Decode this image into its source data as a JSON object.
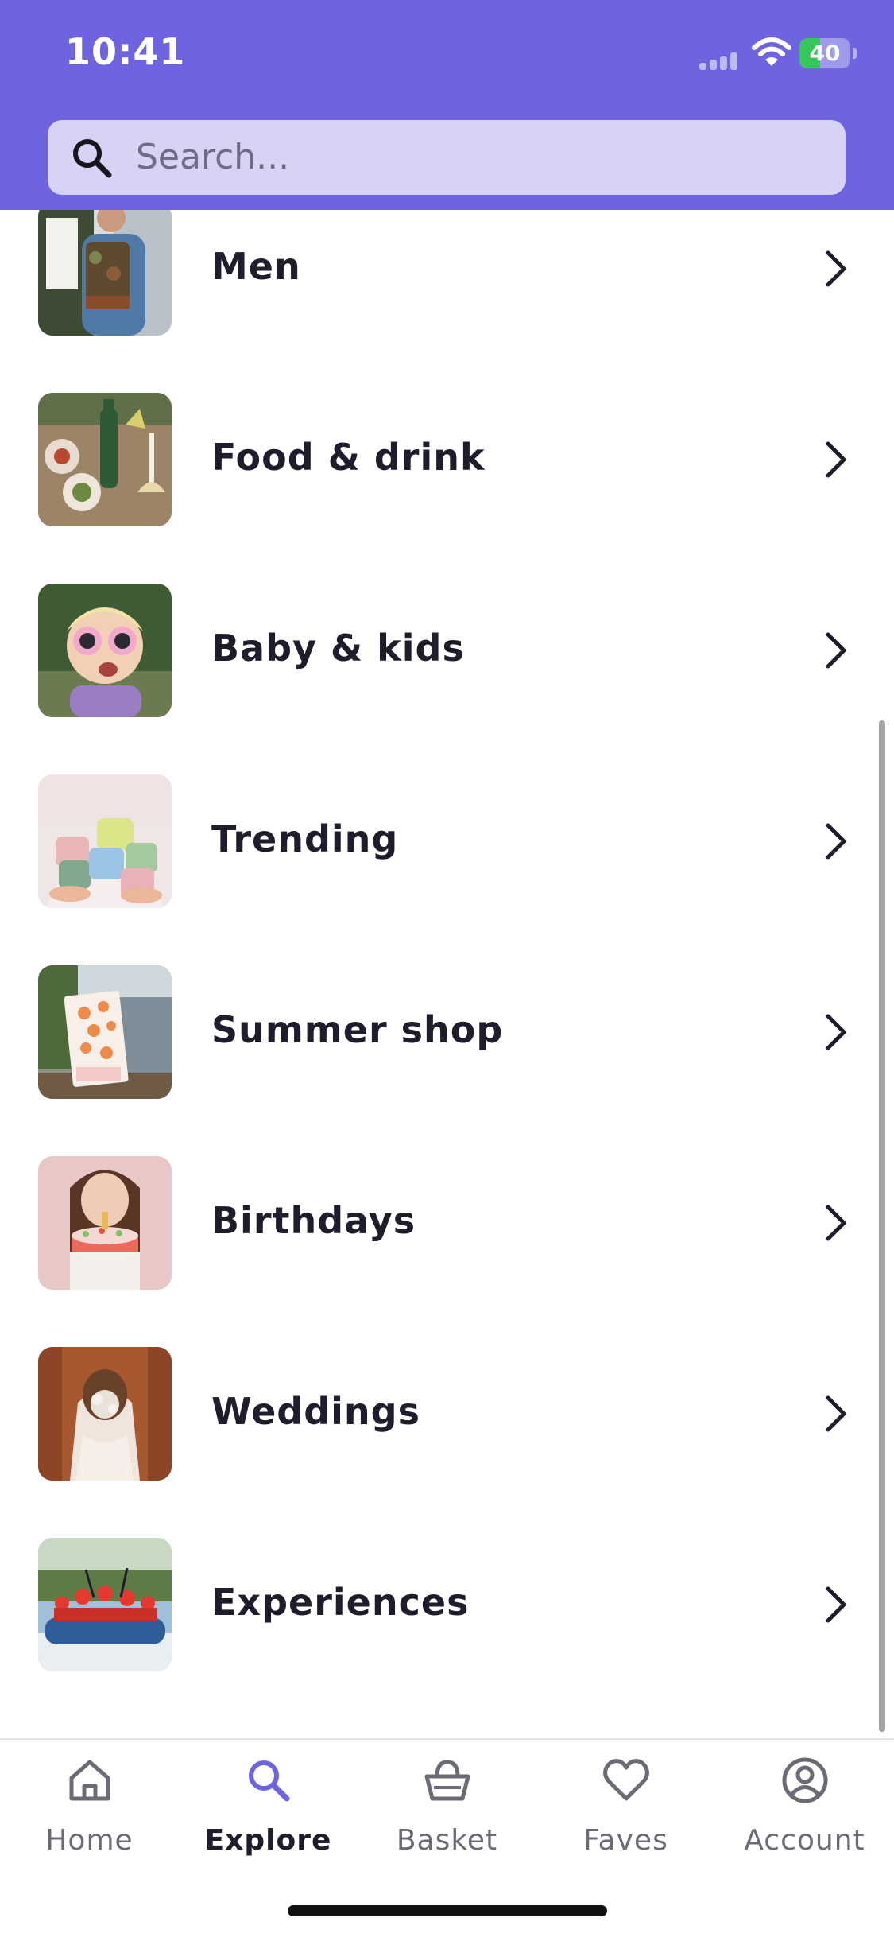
{
  "status_bar": {
    "time": "10:41",
    "battery": "40",
    "battery_level": 0.4
  },
  "search": {
    "placeholder": "Search..."
  },
  "categories": [
    {
      "label": "Men",
      "image": "man-with-backpack-photo"
    },
    {
      "label": "Food & drink",
      "image": "table-with-wine-and-food-photo"
    },
    {
      "label": "Baby & kids",
      "image": "child-with-flower-sunglasses-photo"
    },
    {
      "label": "Trending",
      "image": "stacked-colorful-cups-photo"
    },
    {
      "label": "Summer shop",
      "image": "peach-print-towel-photo"
    },
    {
      "label": "Birthdays",
      "image": "woman-blowing-birthday-cake-photo"
    },
    {
      "label": "Weddings",
      "image": "bride-hair-detail-photo"
    },
    {
      "label": "Experiences",
      "image": "group-rafting-photo"
    }
  ],
  "tabbar": {
    "tabs": [
      {
        "label": "Home",
        "icon": "house-icon",
        "active": false
      },
      {
        "label": "Explore",
        "icon": "search-icon",
        "active": true
      },
      {
        "label": "Basket",
        "icon": "basket-icon",
        "active": false
      },
      {
        "label": "Faves",
        "icon": "heart-icon",
        "active": false
      },
      {
        "label": "Account",
        "icon": "person-circle-icon",
        "active": false
      }
    ]
  },
  "colors": {
    "header_bg": "#6e64df",
    "search_bg": "#d6d3f5",
    "accent": "#6e64df",
    "text_primary": "#1d1d2b",
    "text_secondary": "#6b6b76"
  }
}
